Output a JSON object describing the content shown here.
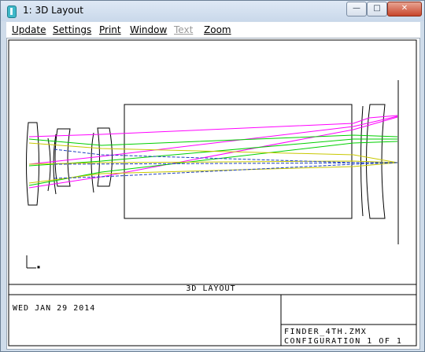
{
  "window": {
    "title": "1: 3D Layout",
    "controls": {
      "minimize": "—",
      "maximize": "□",
      "close": "✕"
    },
    "icon": "zemax-app-icon"
  },
  "menu": [
    {
      "label": "Update",
      "enabled": true
    },
    {
      "label": "Settings",
      "enabled": true
    },
    {
      "label": "Print",
      "enabled": true
    },
    {
      "label": "Window",
      "enabled": true
    },
    {
      "label": "Text",
      "enabled": false
    },
    {
      "label": "Zoom",
      "enabled": true
    }
  ],
  "plot": {
    "caption": "3D LAYOUT",
    "date": "WED JAN 29 2014",
    "filename": "FINDER_4TH.ZMX",
    "configuration": "CONFIGURATION 1 OF 1",
    "ray_colors": {
      "field1": "#1f3fbf",
      "field2": "#00d000",
      "field3": "#ff00ff",
      "field4": "#c8c800"
    }
  }
}
